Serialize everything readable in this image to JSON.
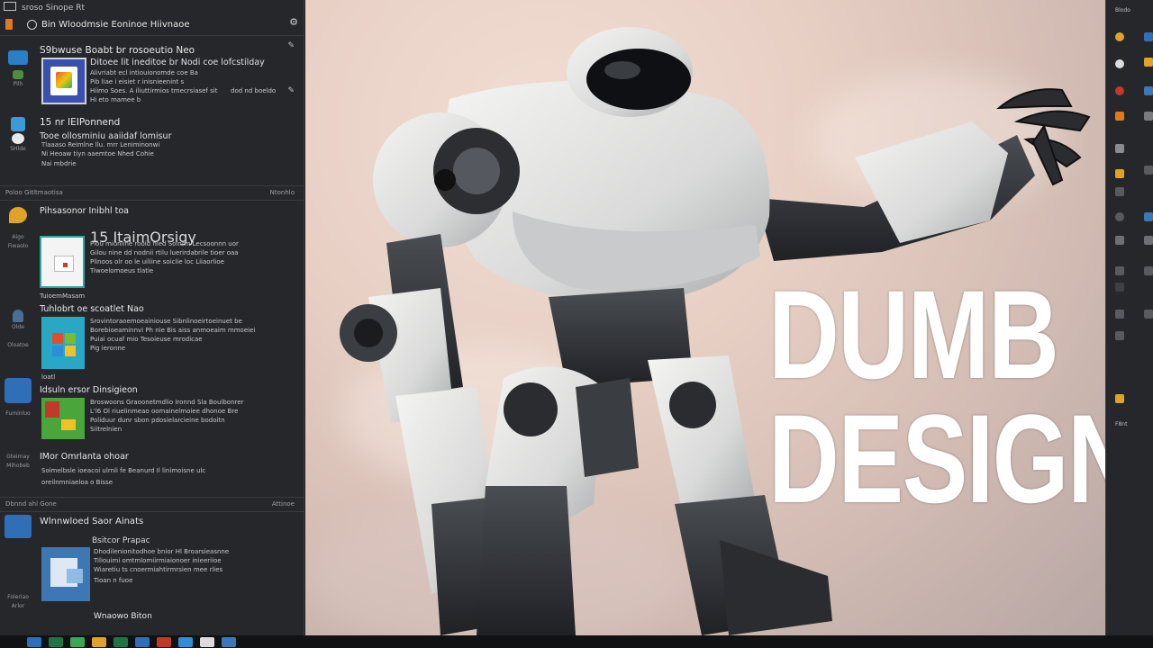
{
  "window": {
    "top_label": "sroso Sinope Rt",
    "sub_label": "Bin Wloodmsie Eoninoe Hiivnaoe"
  },
  "feed": {
    "items": [
      {
        "title": "S9bwuse Boabt br rosoeutio Neo",
        "subtitle": "Ditoee lit ineditoe br Nodi coe lofcstilday",
        "lines": [
          "Alivriabt ecl intiouionomde coe Ba",
          "Pib liae i eisiet r inisnieenint s",
          "Hi eto mamee b",
          "Hiimo Soes. A iliuttirmios tmecrsiasef sit"
        ],
        "meta_right": "dod nd boeldo"
      },
      {
        "title": "15 nr IEIPonnend",
        "subtitle": "Tooe ollosminiu aaiidaf lomisur",
        "lines": [
          "Tlaaaso Reimlne llu. mrr Leniminonwi",
          "Ni Heoaw tiyn aaemtoe Nhed Cohie",
          "Nai mbdrie"
        ]
      },
      {
        "title": "Pihsasonor Inibhl toa",
        "subtitle": "15 ItaimOrsigy",
        "lines": [
          "Plou mioniine rooid nied Soinrm Lecsoonnn uor",
          "Gilou nine dd nodnii rtilu luerirdabrile tioer oaa",
          "Plinoos olr oo le uiliine soiclie loc Liiaorlioe",
          "Tiwoelomoeus tlatie"
        ],
        "meta_below": "TuioemMasam"
      },
      {
        "title": "Tuhlobrt oe scoatlet Nao",
        "lines": [
          "Srovintoraoemoeainiouse Sibnlinoeirtoeinuet be",
          "Borebioeaminnvi Ph nie Bis aiss anmoeaim mmoeiei",
          "Puiai ocuaf mio Tesoieuse mrodicae",
          "Pig ieronne"
        ],
        "meta_below": "loatl"
      },
      {
        "title": "Idsuln ersor Dinsigieon",
        "lines": [
          "Broswoons Graoonetmdlio Ironnd Sla Boulbonrer",
          "L'l6 Ol riuelinmeao oomainelmoiee dhonoe Bre",
          "Poliduur dunr sbon pdosielarcieine bodoitn",
          "Siitrelnien"
        ]
      },
      {
        "title": "IMor Omrlanta ohoar",
        "lines": [
          "Soimelbsle ioeacoi ulrnli fe Beanurd Il linimoisne ulc",
          "oreilnmniaeloa o Bisse"
        ]
      },
      {
        "title": "Wlnnwloed Saor Ainats",
        "subtitle": "Bsitcor Prapac",
        "lines": [
          "Dhodilenionitodhoe bnior Hl Broarsieasnne",
          "Tiliouimi omtmlomiirmiaionoer inieeriioe",
          "Wiaretiu ts cnoermiahtirmrsien mee rlies",
          "Tioan n fuoe"
        ]
      },
      {
        "title": "Wnaowo Biton"
      }
    ],
    "sections": [
      {
        "left": "Poloo Gitltmaotisa",
        "right": "Ntonhlo"
      },
      {
        "left": "Dbnnd ahl Gone",
        "right": "Attinoe"
      }
    ],
    "rail_labels": [
      "Pilh",
      "SHlde",
      "Aigo",
      "Fiwaolo",
      "Olde",
      "Oloatoe",
      "Fuminluo",
      "Gteirnay",
      "Mihobeb",
      "Foleriao",
      "Arlor"
    ]
  },
  "art": {
    "headline_line1": "DUMB",
    "headline_line2": "DESIGN"
  },
  "right_rail": {
    "top_label": "Blodo",
    "bottom_label": "F8nt"
  },
  "colors": {
    "panel_bg": "#26272a",
    "sky_warm": "#e7cfc4",
    "headline": "#ffffff",
    "accent_orange": "#e07b1c"
  }
}
